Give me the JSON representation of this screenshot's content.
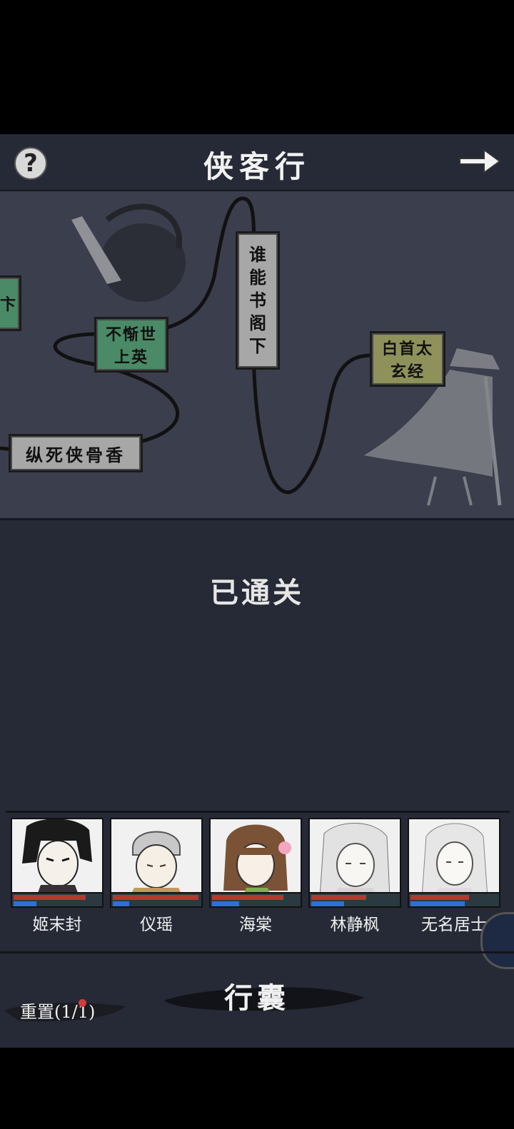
{
  "header": {
    "title": "侠客行",
    "help_icon": "question-mark-icon",
    "next_icon": "arrow-right-icon"
  },
  "map": {
    "nodes": [
      {
        "text": "卞",
        "color": "#4a8a66"
      },
      {
        "text_line1": "不惭世",
        "text_line2": "上英",
        "color": "#4a8a66"
      },
      {
        "text": "纵死侠骨香",
        "color": "#a7a7a7"
      },
      {
        "text_chars": [
          "谁",
          "能",
          "书",
          "阁",
          "下"
        ],
        "color": "#a7a7a7"
      },
      {
        "text_line1": "白首太",
        "text_line2": "玄经",
        "color": "#8e9159"
      }
    ]
  },
  "status": {
    "cleared": "已通关"
  },
  "party": [
    {
      "name": "姬末封",
      "hp": 0.83,
      "mp": 0.26
    },
    {
      "name": "仪瑶",
      "hp": 0.98,
      "mp": 0.19
    },
    {
      "name": "海棠",
      "hp": 0.82,
      "mp": 0.31
    },
    {
      "name": "林静枫",
      "hp": 0.63,
      "mp": 0.38
    },
    {
      "name": "无名居士",
      "hp": 0.67,
      "mp": 0.62
    }
  ],
  "footer": {
    "bag_label": "行囊",
    "reset_label": "重置(1/1)"
  },
  "colors": {
    "background": "#262a36",
    "map_background": "#3b3e4c",
    "hp": "#b3392c",
    "mp": "#2f6fd6"
  }
}
